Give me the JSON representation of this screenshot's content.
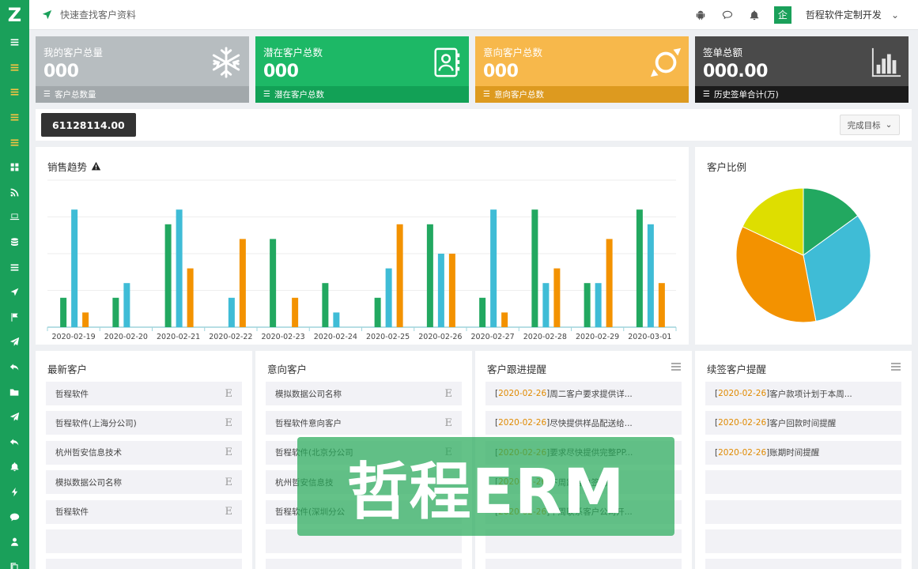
{
  "sidebar": {
    "logo": "Z",
    "items": [
      {
        "icon": "list-icon"
      },
      {
        "icon": "menu-icon"
      },
      {
        "icon": "menu-icon"
      },
      {
        "icon": "menu-icon"
      },
      {
        "icon": "menu-icon"
      },
      {
        "icon": "grid-icon"
      },
      {
        "icon": "rss-icon"
      },
      {
        "icon": "laptop-icon"
      },
      {
        "icon": "database-icon"
      },
      {
        "icon": "list-icon"
      },
      {
        "icon": "location-arrow-icon"
      },
      {
        "icon": "flag-icon"
      },
      {
        "icon": "send-icon"
      },
      {
        "icon": "reply-icon"
      },
      {
        "icon": "folder-icon"
      },
      {
        "icon": "paper-plane-icon"
      },
      {
        "icon": "reply-icon"
      },
      {
        "icon": "bell-icon"
      },
      {
        "icon": "bolt-icon"
      },
      {
        "icon": "chat-icon"
      },
      {
        "icon": "user-icon"
      },
      {
        "icon": "copy-icon"
      }
    ]
  },
  "header": {
    "search_placeholder": "快速查找客户资料",
    "avatar_text": "企",
    "user_name": "哲程软件定制开发",
    "chevron": "⌄"
  },
  "cards": [
    {
      "title": "我的客户总量",
      "value": "000",
      "footer": "客户总数量",
      "icon": "snowflake-icon",
      "color": "#b7bdc0",
      "footer_color": "#a2a8ab"
    },
    {
      "title": "潜在客户总数",
      "value": "000",
      "footer": "潜在客户总数",
      "icon": "contact-book-icon",
      "color": "#1db866",
      "footer_color": "#12a156"
    },
    {
      "title": "意向客户总数",
      "value": "000",
      "footer": "意向客户总数",
      "icon": "target-icon",
      "color": "#f7b84b",
      "footer_color": "#dd9a1f"
    },
    {
      "title": "签单总额",
      "value": "000.00",
      "footer": "历史签单合计(万)",
      "icon": "bar-chart-icon",
      "color": "#4a4a4a",
      "footer_color": "#1b1b1b"
    }
  ],
  "summary": {
    "amount": "61128114.00",
    "goal_button": "完成目标",
    "goal_chevron": "⌄"
  },
  "sales_panel": {
    "title": "销售趋势"
  },
  "ratio_panel": {
    "title": "客户比例"
  },
  "chart_data": [
    {
      "type": "bar",
      "categories": [
        "2020-02-19",
        "2020-02-20",
        "2020-02-21",
        "2020-02-22",
        "2020-02-23",
        "2020-02-24",
        "2020-02-25",
        "2020-02-26",
        "2020-02-27",
        "2020-02-28",
        "2020-02-29",
        "2020-03-01"
      ],
      "series": [
        {
          "values": [
            2,
            2,
            7,
            0,
            6,
            3,
            2,
            7,
            2,
            8,
            3,
            8
          ],
          "color": "#22a860"
        },
        {
          "values": [
            8,
            3,
            8,
            2,
            0,
            1,
            4,
            5,
            8,
            3,
            3,
            7
          ],
          "color": "#3fbcd6"
        },
        {
          "values": [
            1,
            0,
            4,
            6,
            2,
            0,
            7,
            5,
            1,
            4,
            6,
            3
          ],
          "color": "#f39200"
        }
      ],
      "ylim": [
        0,
        10
      ],
      "grid": true
    },
    {
      "type": "pie",
      "slices": [
        {
          "value": 15,
          "color": "#22a860"
        },
        {
          "value": 32,
          "color": "#3fbcd6"
        },
        {
          "value": 35,
          "color": "#f39200"
        },
        {
          "value": 18,
          "color": "#dede00"
        }
      ]
    }
  ],
  "lists": [
    {
      "title": "最新客户",
      "menu": false,
      "rows": [
        {
          "text": "哲程软件",
          "tag": "E"
        },
        {
          "text": "哲程软件(上海分公司)",
          "tag": "E"
        },
        {
          "text": "杭州哲安信息技术",
          "tag": "E"
        },
        {
          "text": "模拟数据公司名称",
          "tag": "E"
        },
        {
          "text": "哲程软件",
          "tag": "E"
        },
        {
          "text": "",
          "tag": ""
        },
        {
          "text": "",
          "tag": ""
        }
      ]
    },
    {
      "title": "意向客户",
      "menu": false,
      "rows": [
        {
          "text": "模拟数据公司名称",
          "tag": "E"
        },
        {
          "text": "哲程软件意向客户",
          "tag": "E"
        },
        {
          "text": "哲程软件(北京分公司",
          "tag": "E"
        },
        {
          "text": "杭州哲安信息技",
          "tag": ""
        },
        {
          "text": "哲程软件(深圳分公",
          "tag": ""
        },
        {
          "text": "",
          "tag": ""
        },
        {
          "text": "",
          "tag": ""
        }
      ]
    },
    {
      "title": "客户跟进提醒",
      "menu": true,
      "rows": [
        {
          "date": "2020-02-26",
          "text": "周二客户要求提供详..."
        },
        {
          "date": "2020-02-26",
          "text": "尽快提供样品配送给..."
        },
        {
          "date": "2020-02-26",
          "text": "要求尽快提供完整PP..."
        },
        {
          "date": "2020-02-26",
          "text": "下周跟客户签约..."
        },
        {
          "date": "2020-02-26",
          "text": "下周联系客户公司开..."
        },
        {
          "date": "",
          "text": ""
        },
        {
          "date": "",
          "text": ""
        }
      ]
    },
    {
      "title": "续签客户提醒",
      "menu": true,
      "rows": [
        {
          "date": "2020-02-26",
          "text": "客户款项计划于本周..."
        },
        {
          "date": "2020-02-26",
          "text": "客户回款时间提醒"
        },
        {
          "date": "2020-02-26",
          "text": "账期时间提醒"
        },
        {
          "date": "",
          "text": ""
        },
        {
          "date": "",
          "text": ""
        },
        {
          "date": "",
          "text": ""
        },
        {
          "date": "",
          "text": ""
        }
      ]
    }
  ],
  "watermark": "哲程ERM"
}
